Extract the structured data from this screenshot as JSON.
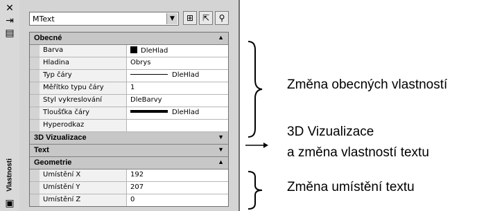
{
  "sidebar": {
    "icons": [
      "close-icon",
      "auto-hide-icon",
      "properties-menu-icon"
    ],
    "title": "Vlastnosti"
  },
  "selector": {
    "value": "MText"
  },
  "toolbar": [
    "toggle-pickadd-icon",
    "select-objects-icon",
    "quick-select-icon"
  ],
  "categories": [
    {
      "title": "Obecné",
      "expanded": true,
      "rows": [
        {
          "key": "Barva",
          "value": "DleHlad",
          "swatch": "#000000"
        },
        {
          "key": "Hladina",
          "value": "Obrys"
        },
        {
          "key": "Typ čáry",
          "value": "DleHlad",
          "line": "thin"
        },
        {
          "key": "Měřítko typu čáry",
          "value": "1"
        },
        {
          "key": "Styl vykreslování",
          "value": "DleBarvy"
        },
        {
          "key": "Tloušťka čáry",
          "value": "DleHlad",
          "line": "thick"
        },
        {
          "key": "Hyperodkaz",
          "value": ""
        }
      ]
    },
    {
      "title": "3D Vizualizace",
      "expanded": false,
      "rows": []
    },
    {
      "title": "Text",
      "expanded": false,
      "rows": []
    },
    {
      "title": "Geometrie",
      "expanded": true,
      "rows": [
        {
          "key": "Umístění X",
          "value": "192"
        },
        {
          "key": "Umístění Y",
          "value": "207"
        },
        {
          "key": "Umístění Z",
          "value": "0"
        }
      ]
    }
  ],
  "annotations": {
    "general": "Změna obecných vlastností",
    "visual_line1": "3D Vizualizace",
    "visual_line2": "a změna vlastností textu",
    "position": "Změna umístění textu"
  }
}
